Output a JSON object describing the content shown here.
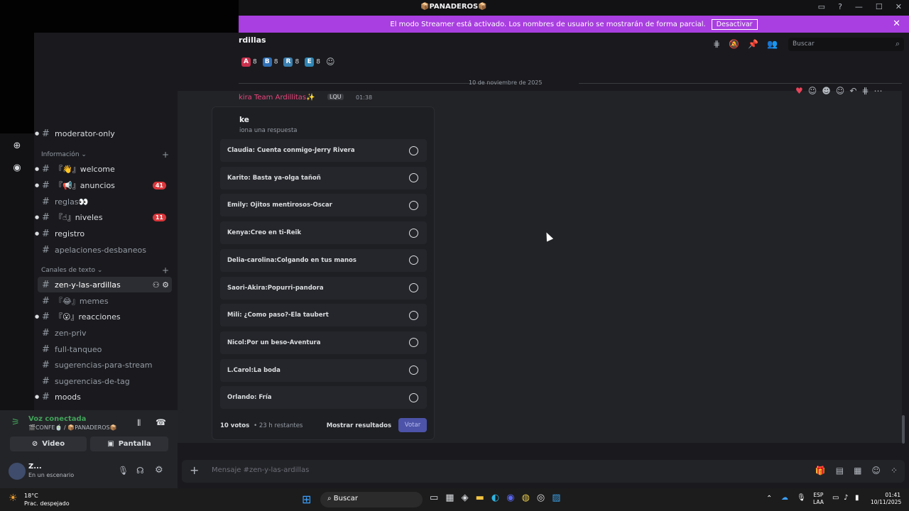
{
  "window": {
    "title": "📦PANADEROS📦"
  },
  "banner": {
    "text": "El modo Streamer está activado. Los nombres de usuario se mostrarán de forma parcial.",
    "button_label": "Desactivar"
  },
  "channel_header": {
    "name": "rdillas"
  },
  "search": {
    "placeholder": "Buscar"
  },
  "role_counts": [
    {
      "letter": "A",
      "count": "8",
      "color": "#c9304d"
    },
    {
      "letter": "B",
      "count": "8",
      "color": "#2f6fb6"
    },
    {
      "letter": "R",
      "count": "8",
      "color": "#3a7fb0"
    },
    {
      "letter": "E",
      "count": "8",
      "color": "#2f86b6"
    }
  ],
  "sidebar": {
    "partial_top": "moderator-only",
    "category_info": "Información",
    "category_text": "Canales de texto",
    "info_channels": [
      {
        "name": "『👋』welcome",
        "badge": "",
        "dim": false,
        "bullet": true
      },
      {
        "name": "『📢』anuncios",
        "badge": "41",
        "dim": false,
        "bullet": true
      },
      {
        "name": "reglas👀",
        "badge": "",
        "dim": true,
        "bullet": false
      },
      {
        "name": "『☝』niveles",
        "badge": "11",
        "dim": false,
        "bullet": true
      },
      {
        "name": "registro",
        "badge": "",
        "dim": false,
        "bullet": true
      },
      {
        "name": "apelaciones-desbaneos",
        "badge": "",
        "dim": true,
        "bullet": false
      }
    ],
    "text_channels": [
      {
        "name": "zen-y-las-ardillas",
        "active": true,
        "dim": false,
        "bullet": false
      },
      {
        "name": "『😂』memes",
        "active": false,
        "dim": true,
        "bullet": false
      },
      {
        "name": "『😮』reacciones",
        "active": false,
        "dim": false,
        "bullet": true
      },
      {
        "name": "zen-priv",
        "active": false,
        "dim": true,
        "bullet": false
      },
      {
        "name": "full-tanqueo",
        "active": false,
        "dim": true,
        "bullet": false
      },
      {
        "name": "sugerencias-para-stream",
        "active": false,
        "dim": true,
        "bullet": false
      },
      {
        "name": "sugerencias-de-tag",
        "active": false,
        "dim": true,
        "bullet": false
      },
      {
        "name": "moods",
        "active": false,
        "dim": false,
        "bullet": true
      }
    ]
  },
  "voice": {
    "status": "Voz conectada",
    "channel": "🎬CONFE🍵 / 📦PANADEROS📦",
    "video_label": "Video",
    "screen_label": "Pantalla"
  },
  "user": {
    "name": "Z...",
    "status": "En un escenario"
  },
  "date_separator": "10 de noviembre de 2025",
  "message": {
    "author": "kira Team Ardillitas✨",
    "tag": "LQU",
    "time": "01:38"
  },
  "poll": {
    "question": "ke",
    "subtitle": "iona una respuesta",
    "options": [
      "Claudia: Cuenta conmigo-Jerry Rivera",
      "Karito: Basta ya-olga tañoñ",
      "Emily: Ojitos mentirosos-Oscar",
      "Kenya:Creo en ti-Reik",
      "Delia-carolina:Colgando en tus manos",
      "Saori-Akira:Popurri-pandora",
      "Mili: ¿Como paso?-Ela taubert",
      "Nicol:Por un beso-Aventura",
      "L.Carol:La boda",
      "Orlando: Fría"
    ],
    "votes": "10 votos",
    "remaining": "23 h restantes",
    "show_results": "Mostrar resultados",
    "vote_label": "Votar"
  },
  "composer": {
    "placeholder": "Mensaje #zen-y-las-ardillas"
  },
  "taskbar": {
    "temp": "18°C",
    "weather": "Prac. despejado",
    "search": "Buscar",
    "lang1": "ESP",
    "lang2": "LAA",
    "time": "01:41",
    "date": "10/11/2025"
  }
}
